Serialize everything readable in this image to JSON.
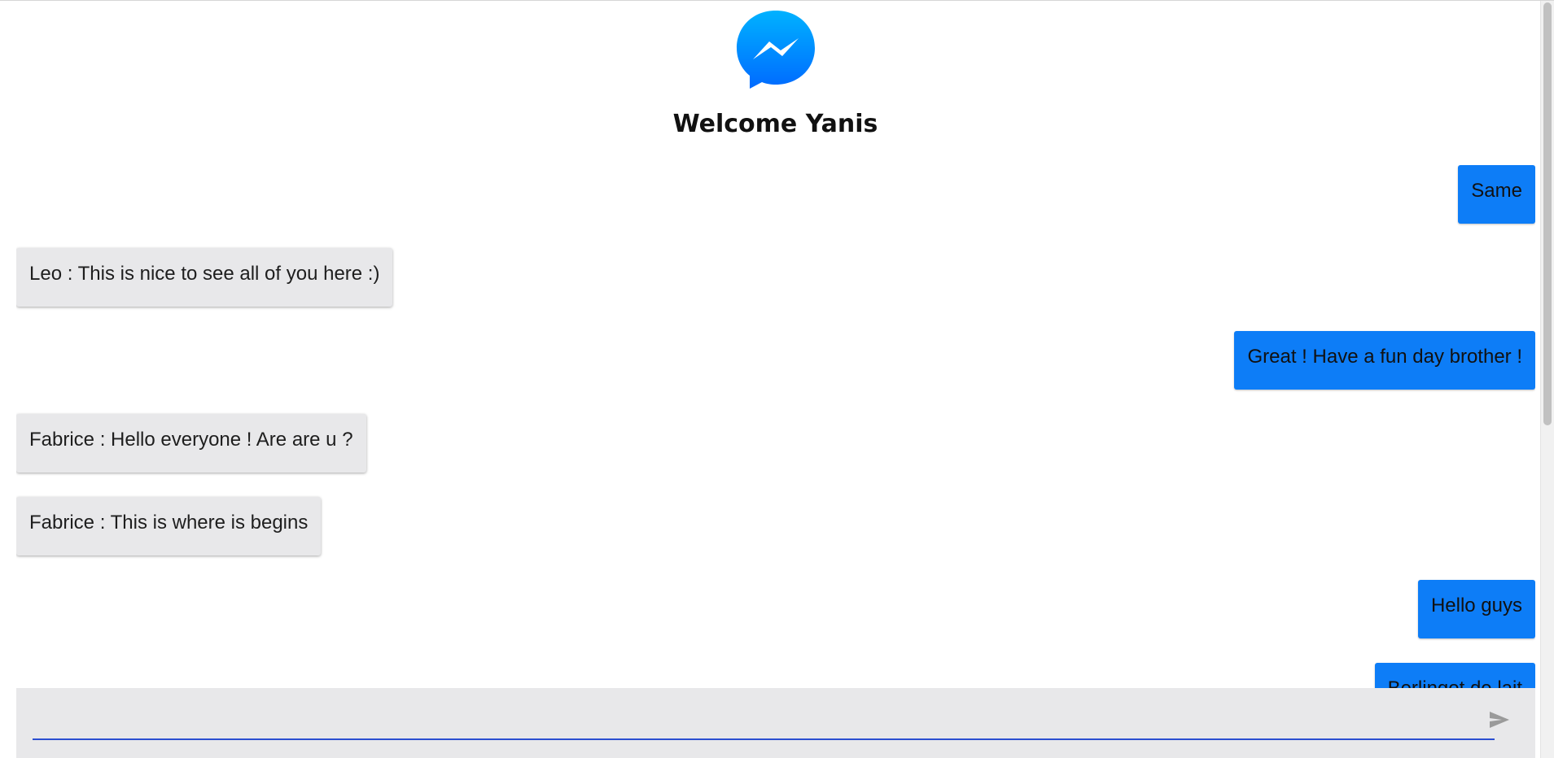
{
  "header": {
    "title": "Welcome Yanis",
    "logo": "messenger-logo-icon",
    "brand_color": "#0a84ff"
  },
  "messages": [
    {
      "side": "right",
      "text": "Same"
    },
    {
      "side": "left",
      "text": "Leo : This is nice to see all of you here :)"
    },
    {
      "side": "right",
      "text": "Great ! Have a fun day brother !"
    },
    {
      "side": "left",
      "text": "Fabrice : Hello everyone ! Are are u ?"
    },
    {
      "side": "left",
      "text": "Fabrice : This is where is begins"
    },
    {
      "side": "right",
      "text": "Hello guys"
    },
    {
      "side": "right",
      "text": "Berlingot de lait"
    }
  ],
  "composer": {
    "value": "",
    "send_icon": "send-icon"
  },
  "colors": {
    "own_bubble": "#0d7df7",
    "other_bubble": "#e8e8ea",
    "input_underline": "#2b4ed1"
  }
}
